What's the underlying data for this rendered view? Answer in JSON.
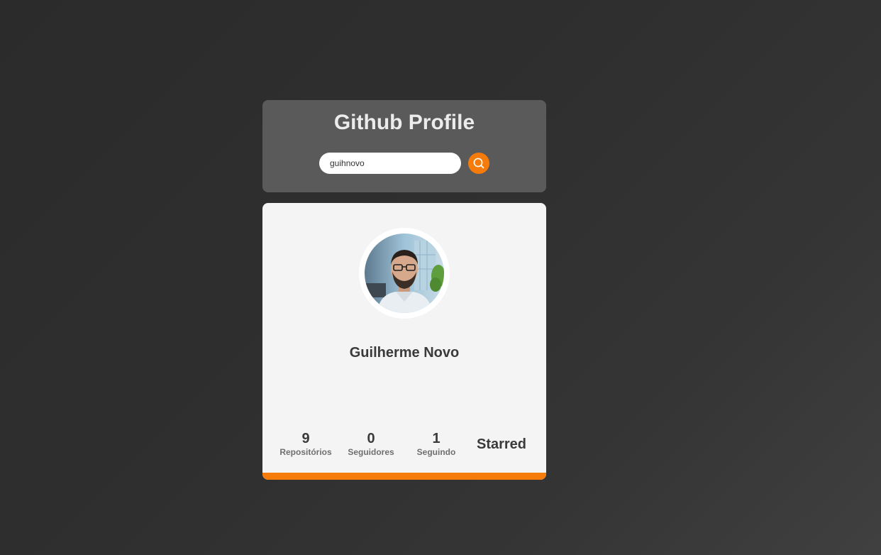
{
  "header": {
    "title": "Github Profile"
  },
  "search": {
    "value": "guihnovo",
    "button_icon": "search-icon"
  },
  "profile": {
    "avatar_icon": "user-avatar-photo",
    "name": "Guilherme Novo",
    "stats": [
      {
        "value": "9",
        "label": "Repositórios"
      },
      {
        "value": "0",
        "label": "Seguidores"
      },
      {
        "value": "1",
        "label": "Seguindo"
      }
    ],
    "starred_label": "Starred"
  },
  "colors": {
    "accent": "#f57c0a",
    "header_bg": "#5a5a5a",
    "card_bg": "#f4f4f4",
    "page_bg": "#2f2f2f"
  }
}
